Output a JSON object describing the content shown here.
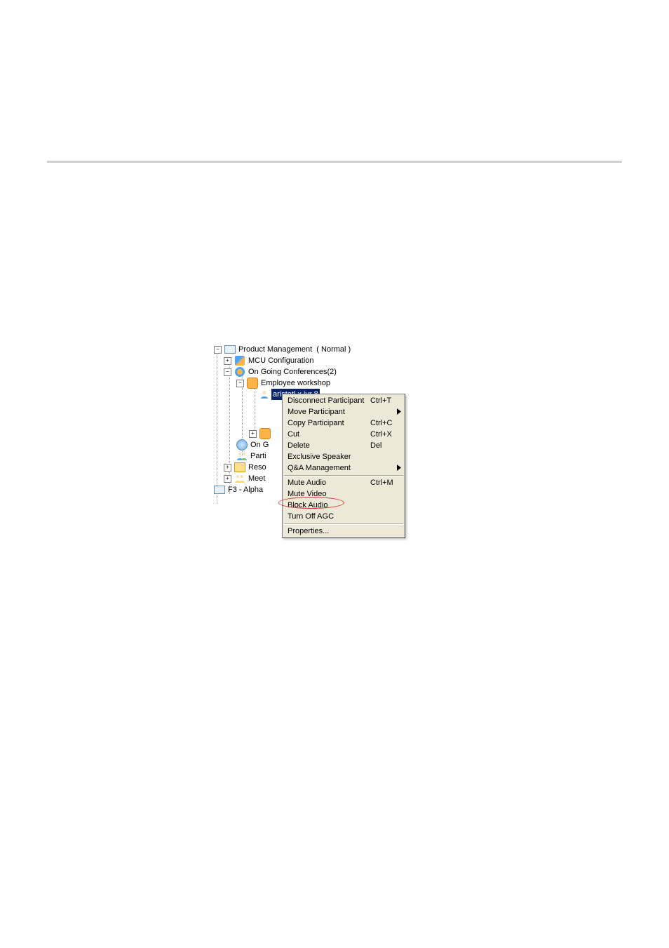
{
  "tree": {
    "root_label": "Product Management",
    "root_status": "( Normal )",
    "mcu_config": "MCU Configuration",
    "ongoing": "On Going Conferences(2)",
    "conf_name": "Employee workshop",
    "participant_highlight": "aristotl x ivr 8",
    "ong_label": "On G",
    "parti_label": "Parti",
    "reso_label": "Reso",
    "meet_label": "Meet",
    "alpha_label": "F3 - Alpha"
  },
  "menu": {
    "items": [
      {
        "label": "Disconnect Participant",
        "shortcut": "Ctrl+T",
        "arrow": false
      },
      {
        "label": "Move Participant",
        "shortcut": "",
        "arrow": true
      },
      {
        "label": "Copy Participant",
        "shortcut": "Ctrl+C",
        "arrow": false
      },
      {
        "label": "Cut",
        "shortcut": "Ctrl+X",
        "arrow": false
      },
      {
        "label": "Delete",
        "shortcut": "Del",
        "arrow": false
      },
      {
        "label": "Exclusive Speaker",
        "shortcut": "",
        "arrow": false
      },
      {
        "label": "Q&A Management",
        "shortcut": "",
        "arrow": true
      }
    ],
    "items2": [
      {
        "label": "Mute Audio",
        "shortcut": "Ctrl+M",
        "arrow": false
      },
      {
        "label": "Mute Video",
        "shortcut": "",
        "arrow": false
      },
      {
        "label": "Block Audio",
        "shortcut": "",
        "arrow": false
      },
      {
        "label": "Turn Off AGC",
        "shortcut": "",
        "arrow": false
      }
    ],
    "properties_label": "Properties..."
  }
}
